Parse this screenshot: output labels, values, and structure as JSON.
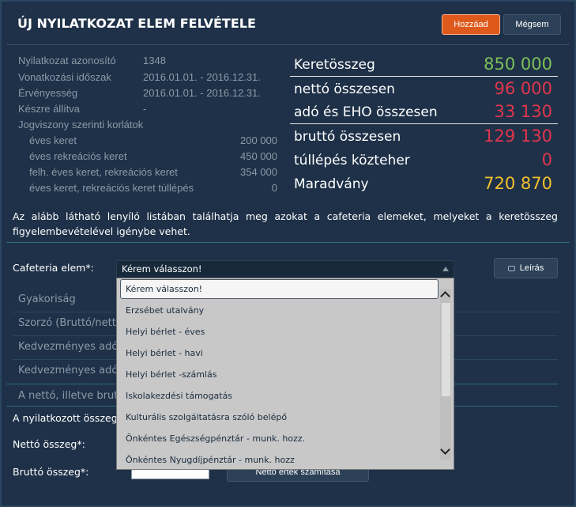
{
  "header": {
    "title": "ÚJ NYILATKOZAT ELEM FELVÉTELE",
    "add_label": "Hozzáad",
    "cancel_label": "Mégsem"
  },
  "info": {
    "id_label": "Nyilatkozat azonosító",
    "id_value": "1348",
    "period_label": "Vonatkozási időszak",
    "period_value": "2016.01.01. - 2016.12.31.",
    "validity_label": "Érvényesség",
    "validity_value": "2016.01.01. - 2016.12.31.",
    "created_by_label": "Készre állítva",
    "created_by_value": "-",
    "limits_label": "Jogviszony szerinti korlátok",
    "limits": [
      {
        "label": "éves keret",
        "value": "200 000"
      },
      {
        "label": "éves rekreációs keret",
        "value": "450 000"
      },
      {
        "label": "felh. éves keret, rekreációs keret",
        "value": "354 000"
      },
      {
        "label": "éves keret, rekreációs keret túllépés",
        "value": "0"
      }
    ]
  },
  "summary": {
    "rows": [
      {
        "label": "Keretösszeg",
        "value": "850 000",
        "color": "#7ec05a"
      },
      {
        "label": "nettó összesen",
        "value": "96 000",
        "color": "#e0364d"
      },
      {
        "label": "adó és EHO összesen",
        "value": "33 130",
        "color": "#e0364d"
      },
      {
        "label": "bruttó összesen",
        "value": "129 130",
        "color": "#e0364d"
      },
      {
        "label": "túllépés közteher",
        "value": "0",
        "color": "#e0364d"
      },
      {
        "label": "Maradvány",
        "value": "720 870",
        "color": "#f3c02e"
      }
    ]
  },
  "description": "Az alább látható lenyíló listában találhatja meg azokat a cafeteria elemeket, melyeket a keretösszeg figyelembevételével igénybe vehet.",
  "form": {
    "element_label": "Cafeteria elem*:",
    "select_value": "Kérem válasszon!",
    "desc_button": "Leírás",
    "frequency_label": "Gyakoriság",
    "multiplier_label": "Szorzó (Bruttó/nett",
    "beneficiary1_label": "Kedvezményes adó",
    "beneficiary2_label": "Kedvezményes adó",
    "note_label": "A nettó, illetve brut",
    "declared_label": "A nyilatkozott összeg n",
    "net_label": "Nettó összeg*:",
    "gross_label": "Bruttó összeg*:",
    "calc_button": "Nettó érték számítása"
  },
  "dropdown": {
    "options": [
      "Kérem válasszon!",
      "Erzsébet utalvány",
      "Helyi bérlet - éves",
      "Helyi bérlet - havi",
      "Helyi bérlet -számlás",
      "Iskolakezdési támogatás",
      "Kulturális szolgáltatásra szóló belépő",
      "Önkéntes Egészségpénztár - munk. hozz.",
      "Önkéntes Nyugdíjpénztár - munk. hozz"
    ]
  }
}
